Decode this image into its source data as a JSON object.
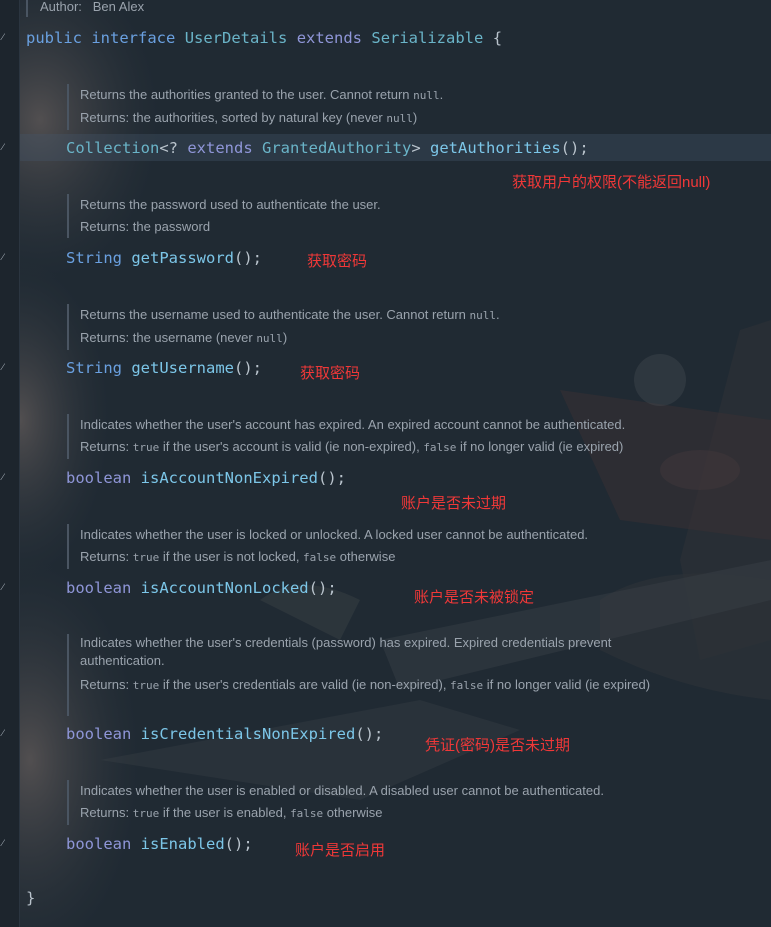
{
  "header": {
    "author_label": "Author:",
    "author_name": "Ben Alex"
  },
  "interface_decl": {
    "kw_public": "public",
    "kw_interface": "interface",
    "name": "UserDetails",
    "kw_extends": "extends",
    "parent": "Serializable",
    "open_brace": "{"
  },
  "methods": [
    {
      "doc_lines": [
        "Returns the authorities granted to the user. Cannot return ",
        "Returns: the authorities, sorted by natural key (never "
      ],
      "doc_code": [
        "null",
        "null"
      ],
      "doc_suffix": [
        ".",
        ")"
      ],
      "return_type": "Collection",
      "generic": "<? extends GrantedAuthority>",
      "generic_open": "<? ",
      "generic_kw": "extends",
      "generic_type": "GrantedAuthority",
      "generic_close": ">",
      "name": "getAuthorities",
      "parens": "();",
      "annotation": "获取用户的权限(不能返回null)"
    },
    {
      "doc_lines": [
        "Returns the password used to authenticate the user.",
        "Returns: the password"
      ],
      "return_type": "String",
      "name": "getPassword",
      "parens": "();",
      "annotation": "获取密码"
    },
    {
      "doc_lines": [
        "Returns the username used to authenticate the user. Cannot return ",
        "Returns: the username (never "
      ],
      "doc_code": [
        "null",
        "null"
      ],
      "doc_suffix": [
        ".",
        ")"
      ],
      "return_type": "String",
      "name": "getUsername",
      "parens": "();",
      "annotation": "获取密码"
    },
    {
      "doc_line1": "Indicates whether the user's account has expired. An expired account cannot be authenticated.",
      "doc_l2a": "Returns: ",
      "doc_l2_true": "true",
      "doc_l2b": " if the user's account is valid (ie non-expired), ",
      "doc_l2_false": "false",
      "doc_l2c": " if no longer valid (ie expired)",
      "return_type": "boolean",
      "name": "isAccountNonExpired",
      "parens": "();",
      "annotation": "账户是否未过期"
    },
    {
      "doc_line1": "Indicates whether the user is locked or unlocked. A locked user cannot be authenticated.",
      "doc_l2a": "Returns: ",
      "doc_l2_true": "true",
      "doc_l2b": " if the user is not locked, ",
      "doc_l2_false": "false",
      "doc_l2c": " otherwise",
      "return_type": "boolean",
      "name": "isAccountNonLocked",
      "parens": "();",
      "annotation": "账户是否未被锁定"
    },
    {
      "doc_line1": "Indicates whether the user's credentials (password) has expired. Expired credentials prevent",
      "doc_line1b": "authentication.",
      "doc_l2a": "Returns: ",
      "doc_l2_true": "true",
      "doc_l2b": " if the user's credentials are valid (ie non-expired), ",
      "doc_l2_false": "false",
      "doc_l2c": " if no longer valid (ie expired)",
      "return_type": "boolean",
      "name": "isCredentialsNonExpired",
      "parens": "();",
      "annotation": "凭证(密码)是否未过期"
    },
    {
      "doc_line1": "Indicates whether the user is enabled or disabled. A disabled user cannot be authenticated.",
      "doc_l2a": "Returns: ",
      "doc_l2_true": "true",
      "doc_l2b": " if the user is enabled, ",
      "doc_l2_false": "false",
      "doc_l2c": " otherwise",
      "return_type": "boolean",
      "name": "isEnabled",
      "parens": "();",
      "annotation": "账户是否启用"
    }
  ],
  "close_brace": "}",
  "colors": {
    "background": "#202a33",
    "keyword": "#6aa0e0",
    "method": "#7cc6e8",
    "annotation": "#f03838",
    "doc_text": "#9aa3ad"
  }
}
